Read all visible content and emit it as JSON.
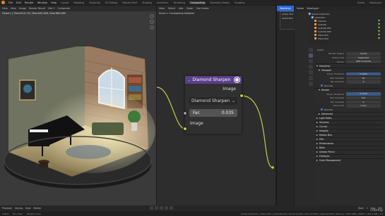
{
  "menu": {
    "items": [
      "File",
      "Edit",
      "Render",
      "Window",
      "Help"
    ],
    "workspace_tabs": [
      "Layout",
      "Modeling",
      "Sculpting",
      "UV Editing",
      "Texture Paint",
      "Shading",
      "Animation",
      "Rendering",
      "Compositing",
      "Geometry Nodes",
      "Scripting"
    ],
    "active_tab": "Compositing",
    "scene": "Scene",
    "view_layer": "ViewLayer"
  },
  "viewport": {
    "header": [
      "View",
      "View",
      "Image",
      "Render Result",
      "Slot 1",
      "Composite"
    ],
    "info": "Frame:1 | Time:00:02.19 | Mem:645.00M, Peak:680.00M"
  },
  "compositor": {
    "header": [
      "View",
      "Select",
      "Add",
      "Node",
      "Use Nodes"
    ],
    "breadcrumb": "Scene  >  Compositing Nodetree",
    "node": {
      "title": "Diamond Sharpen",
      "output_label": "Image",
      "mode": "Diamond Sharpen",
      "fac_label": "Fac",
      "fac_value": "0.035",
      "input_label": "Image"
    }
  },
  "sidebar": {
    "top": "Backdrop",
    "panel_title": "Active Tool",
    "panel_item": "Select Box"
  },
  "scene_header": [
    "Scene",
    "ViewLayer"
  ],
  "outliner": {
    "title": "Scene Collection",
    "items": [
      {
        "name": "Collection",
        "level": 0
      },
      {
        "name": "Camera",
        "level": 1
      },
      {
        "name": "Cylinder",
        "level": 1
      },
      {
        "name": "Cylinder.001",
        "level": 1
      },
      {
        "name": "Cylinder.002",
        "level": 1
      },
      {
        "name": "Plane.001",
        "level": 1
      },
      {
        "name": "Plane.002",
        "level": 1
      }
    ]
  },
  "properties": {
    "scene_label": "Scene",
    "render_engine_label": "Render Engine",
    "render_engine": "Cycles",
    "feature_set_label": "Feature Set",
    "feature_set": "Supported",
    "device_label": "Device",
    "device": "GPU Compute",
    "sampling": "Sampling",
    "viewport": "Viewport",
    "noise_threshold_label": "Noise Threshold",
    "noise_threshold_vp": "0.1000",
    "max_samples_label": "Max Samples",
    "max_samples_vp": "64",
    "min_samples_label": "Min Samples",
    "min_samples_vp": "0",
    "denoise": "Denoise",
    "render": "Render",
    "noise_threshold_r": "0.0100",
    "max_samples_r": "512",
    "min_samples_r": "0",
    "time_limit_label": "Time Limit",
    "time_limit": "0 sec",
    "denoise_r": "Denoise",
    "advanced": "Advanced",
    "sections": [
      "Light Paths",
      "Volumes",
      "Curves",
      "Simplify",
      "Motion Blur",
      "Film",
      "Performance",
      "Bake",
      "Grease Pencil",
      "Freestyle",
      "Color Management"
    ]
  },
  "timeline": {
    "items": [
      "Playback",
      "Keying",
      "View",
      "Marker"
    ],
    "start_label": "Start",
    "start": "1",
    "end_label": "End",
    "end": "250"
  },
  "status": {
    "left": [
      "Select",
      "Pan View",
      "Sample Color"
    ],
    "right": "Scene Collection | Plane.003 | Verts:60,200 | Faces:54,250 | Tris:107,950 | Objects:0/38 | Memory: 760.5 MiB | VRAM: 1.8/4.0 GiB | 3.2"
  },
  "watermark": "Udemy",
  "colors": {
    "node_header": "#5b3f8c",
    "wire": "#c6cc4b",
    "accent": "#2b6ad8"
  }
}
